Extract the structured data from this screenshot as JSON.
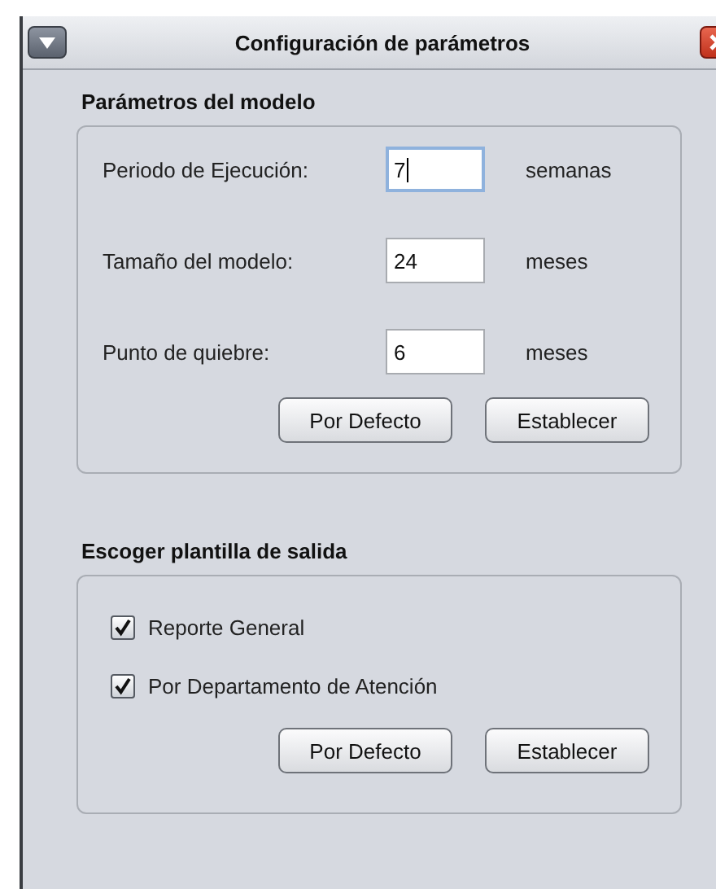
{
  "window": {
    "title": "Configuración de parámetros"
  },
  "model_group": {
    "title": "Parámetros del modelo",
    "fields": [
      {
        "label": "Periodo de Ejecución:",
        "value": "7",
        "unit": "semanas",
        "focused": true
      },
      {
        "label": "Tamaño del modelo:",
        "value": "24",
        "unit": "meses",
        "focused": false
      },
      {
        "label": "Punto de quiebre:",
        "value": "6",
        "unit": "meses",
        "focused": false
      }
    ],
    "buttons": [
      "Por Defecto",
      "Establecer"
    ]
  },
  "template_group": {
    "title": "Escoger plantilla de salida",
    "options": [
      {
        "label": "Reporte General",
        "checked": true
      },
      {
        "label": "Por Departamento de Atención",
        "checked": true
      }
    ],
    "buttons": [
      "Por Defecto",
      "Establecer"
    ]
  }
}
